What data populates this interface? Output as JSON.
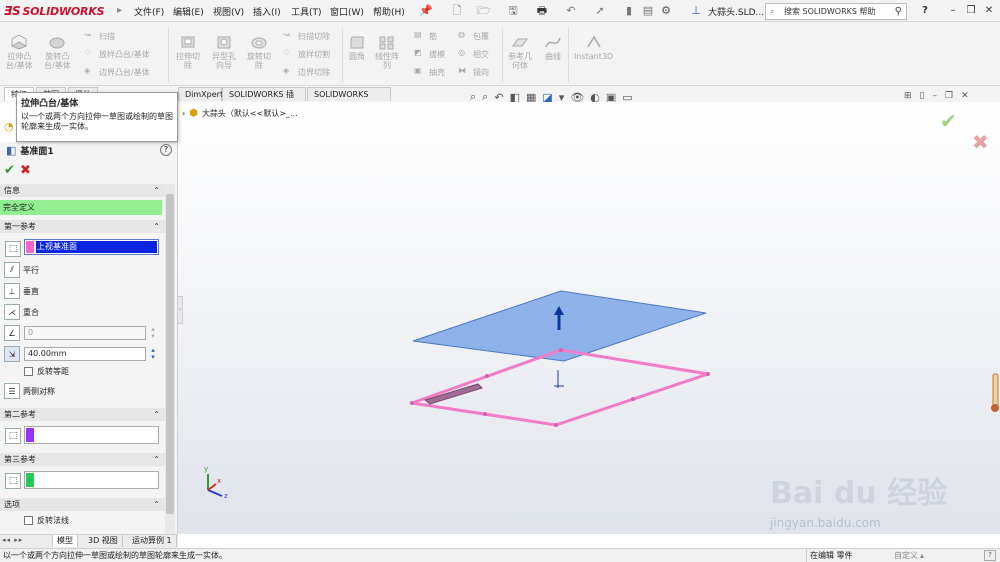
{
  "app": {
    "logo_text": "SOLIDWORKS",
    "logo_color": "#c8102e"
  },
  "menu": [
    "文件(F)",
    "编辑(E)",
    "视图(V)",
    "插入(I)",
    "工具(T)",
    "窗口(W)",
    "帮助(H)"
  ],
  "document_title": "大蒜头.SLD...",
  "help_search": {
    "placeholder": "搜索 SOLIDWORKS 帮助"
  },
  "ribbon": {
    "extrude_boss": "拉伸凸\n台/基体",
    "revolve_boss": "旋转凸\n台/基体",
    "sweep": "扫描",
    "loft_boss": "放样凸台/基体",
    "boundary_boss": "边界凸台/基体",
    "extrude_cut": "拉伸切\n除",
    "hole_wizard": "异型孔\n向导",
    "revolve_cut": "旋转切\n除",
    "sweep_cut": "扫描切除",
    "loft_cut": "放样切割",
    "boundary_cut": "边界切除",
    "fillet": "圆角",
    "linear_pattern": "线性阵\n列",
    "rib": "筋",
    "draft": "拔模",
    "shell": "抽壳",
    "wrap": "包覆",
    "intersect": "相交",
    "mirror": "镜向",
    "ref_geometry": "参考几\n何体",
    "curves": "曲线",
    "instant3d": "Instant3D"
  },
  "command_tabs": [
    "特征",
    "草图",
    "评估",
    "DimXpert",
    "SOLIDWORKS 插件",
    "SOLIDWORKS MBD"
  ],
  "tooltip": {
    "title": "拉伸凸台/基体",
    "description": "以一个或两个方向拉伸一草图或绘制的草图轮廓来生成一实体。"
  },
  "feature_tree": {
    "root": "大蒜头（默认<<默认>_..."
  },
  "property_manager": {
    "title": "基准面1",
    "info_header": "信息",
    "status": "完全定义",
    "status_color": "#90ee90",
    "first_ref_header": "第一参考",
    "first_ref_value": "上视基准面",
    "first_ref_color": "#ff66cc",
    "options": {
      "parallel": "平行",
      "perpendicular": "垂直",
      "coincident": "重合"
    },
    "angle_value": "0",
    "distance_value": "40.00mm",
    "flip_offset": "反转等距",
    "mid_plane": "两侧对称",
    "second_ref_header": "第二参考",
    "second_ref_color": "#9b30ff",
    "third_ref_header": "第三参考",
    "third_ref_color": "#22cc55",
    "options_header": "选项",
    "flip_normal": "反转法线"
  },
  "bottom_tabs": [
    "模型",
    "3D 视图",
    "运动算例 1"
  ],
  "status_bar": {
    "message": "以一个或两个方向拉伸一草图或绘制的草图轮廓来生成一实体。",
    "mode": "在编辑 零件",
    "custom": "自定义"
  },
  "triad": {
    "x": "x",
    "y": "y",
    "z": "z"
  },
  "watermark": {
    "brand": "Bai du 经验",
    "url": "jingyan.baidu.com"
  }
}
